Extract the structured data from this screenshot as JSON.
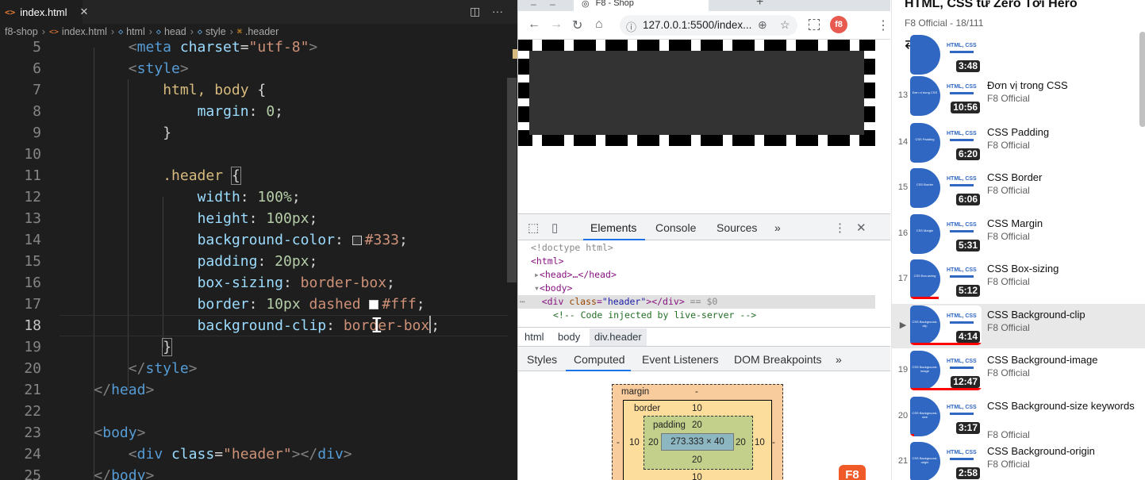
{
  "editor": {
    "tab": {
      "name": "index.html",
      "icon": "html-icon"
    },
    "breadcrumb": [
      "f8-shop",
      "index.html",
      "html",
      "head",
      "style",
      ".header"
    ],
    "actions": [
      "split-editor-icon",
      "more-icon"
    ]
  },
  "code": [
    {
      "n": "5",
      "text": "<meta charset=\"utf-8\">"
    },
    {
      "n": "6",
      "text": "<style>"
    },
    {
      "n": "7",
      "text": "html, body {"
    },
    {
      "n": "8",
      "text": "margin: 0;"
    },
    {
      "n": "9",
      "text": "}"
    },
    {
      "n": "10",
      "text": ""
    },
    {
      "n": "11",
      "text": ".header {"
    },
    {
      "n": "12",
      "text": "width: 100%;"
    },
    {
      "n": "13",
      "text": "height: 100px;"
    },
    {
      "n": "14",
      "text": "background-color: #333;"
    },
    {
      "n": "15",
      "text": "padding: 20px;"
    },
    {
      "n": "16",
      "text": "box-sizing: border-box;"
    },
    {
      "n": "17",
      "text": "border: 10px dashed #fff;"
    },
    {
      "n": "18",
      "text": "background-clip: border-box;"
    },
    {
      "n": "19",
      "text": "}"
    },
    {
      "n": "20",
      "text": "</style>"
    },
    {
      "n": "21",
      "text": "</head>"
    },
    {
      "n": "22",
      "text": ""
    },
    {
      "n": "23",
      "text": "<body>"
    },
    {
      "n": "24",
      "text": "<div class=\"header\"></div>"
    },
    {
      "n": "25",
      "text": "</body>"
    }
  ],
  "swatch_colors": {
    "dark": "#333333",
    "light": "#ffffff"
  },
  "browser": {
    "tab_title": "F8 - Shop",
    "url": "127.0.0.1:5500/index...",
    "extension_label": "f8",
    "demo_header": {
      "background": "#333333",
      "border_color": "#ffffff"
    }
  },
  "devtools": {
    "tabs": [
      "Elements",
      "Console",
      "Sources",
      "»"
    ],
    "dom": {
      "doctype": "<!doctype html>",
      "html_open": "<html>",
      "head": "<head>…</head>",
      "body_open": "<body>",
      "div_tag_open": "<div ",
      "div_attr_name": "class",
      "div_attr_val": "\"header\"",
      "div_tag_close": "></div>",
      "div_eq": " == $0",
      "comment": "<!-- Code injected by live-server -->"
    },
    "crumbs": [
      "html",
      "body",
      "div.header"
    ],
    "subtabs": [
      "Styles",
      "Computed",
      "Event Listeners",
      "DOM Breakpoints",
      "»"
    ],
    "box_model": {
      "margin_label": "margin",
      "margin": "-",
      "border_label": "border",
      "border": "10",
      "padding_label": "padding",
      "padding": "20",
      "content": "273.333 × 40",
      "left_margin": "-",
      "left_border": "10",
      "left_padding": "20",
      "right_padding": "20",
      "right_border": "10",
      "right_margin": "-",
      "bottom_padding": "20",
      "bottom_border": "10"
    },
    "corner_logo": "F8"
  },
  "playlist": {
    "title": "HTML, CSS từ Zero Tới Hero",
    "subtitle": "F8 Official - 18/111",
    "thumb_text": "HTML, CSS",
    "items": [
      {
        "index": "",
        "title": "",
        "channel": "",
        "duration": "3:48"
      },
      {
        "index": "13",
        "title": "Đơn vị trong CSS",
        "channel": "F8 Official",
        "duration": "10:56",
        "thumb": "Đơn vị trong CSS"
      },
      {
        "index": "14",
        "title": "CSS Padding",
        "channel": "F8 Official",
        "duration": "6:20",
        "thumb": "CSS Padding"
      },
      {
        "index": "15",
        "title": "CSS Border",
        "channel": "F8 Official",
        "duration": "6:06",
        "thumb": "CSS Border"
      },
      {
        "index": "16",
        "title": "CSS Margin",
        "channel": "F8 Official",
        "duration": "5:31",
        "thumb": "CSS Margin"
      },
      {
        "index": "17",
        "title": "CSS Box-sizing",
        "channel": "F8 Official",
        "duration": "5:12",
        "thumb": "CSS Box-sizing",
        "watched": 0.4
      },
      {
        "index": "▶",
        "title": "CSS Background-clip",
        "channel": "F8 Official",
        "duration": "4:14",
        "thumb": "CSS Background-clip",
        "watched": 1.0,
        "current": true
      },
      {
        "index": "19",
        "title": "CSS Background-image",
        "channel": "F8 Official",
        "duration": "12:47",
        "thumb": "CSS Background-image",
        "watched": 1.0
      },
      {
        "index": "20",
        "title": "CSS Background-size keywords",
        "channel": "F8 Official",
        "duration": "3:17",
        "thumb": "CSS Background-size",
        "watched": 0.05
      },
      {
        "index": "21",
        "title": "CSS Background-origin",
        "channel": "F8 Official",
        "duration": "2:58",
        "thumb": "CSS Background-origin"
      }
    ]
  }
}
